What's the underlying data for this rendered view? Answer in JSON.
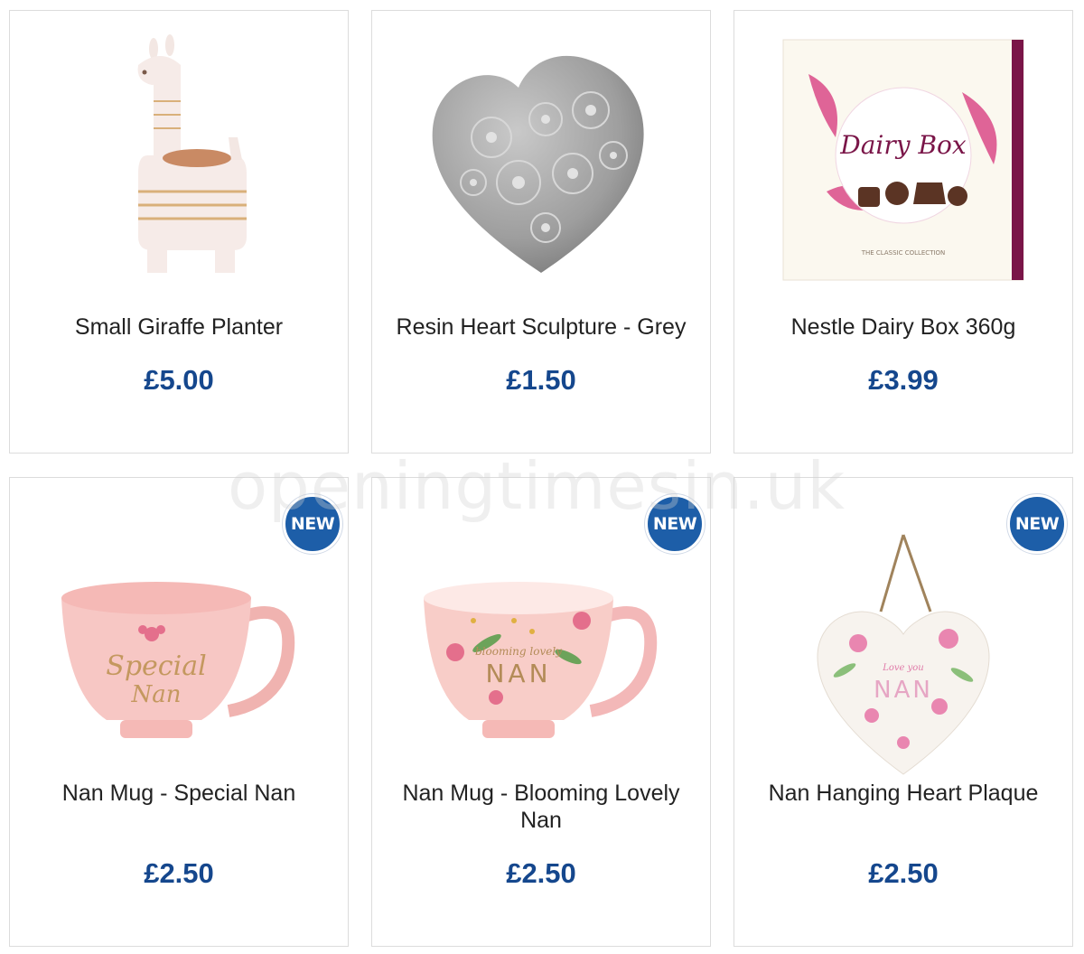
{
  "products": [
    {
      "name": "Small Giraffe Planter",
      "price": "£5.00",
      "image": "giraffe-planter"
    },
    {
      "name": "Resin Heart Sculpture - Grey",
      "price": "£1.50",
      "image": "heart-sculpture"
    },
    {
      "name": "Nestle Dairy Box 360g",
      "price": "£3.99",
      "image": "dairy-box"
    },
    {
      "name": "Nan Mug - Special Nan",
      "price": "£2.50",
      "image": "special-nan-mug",
      "badge": "NEW"
    },
    {
      "name": "Nan Mug - Blooming Lovely Nan",
      "price": "£2.50",
      "image": "blooming-nan-mug",
      "badge": "NEW"
    },
    {
      "name": "Nan Hanging Heart Plaque",
      "price": "£2.50",
      "image": "heart-plaque",
      "badge": "NEW"
    }
  ],
  "images": {
    "dairy_box_brand": "Dairy Box",
    "dairy_box_tagline": "THE CLASSIC COLLECTION",
    "special_mug_text_1": "Special",
    "special_mug_text_2": "Nan",
    "blooming_mug_text_1": "blooming lovely",
    "blooming_mug_text_2": "NAN",
    "plaque_text_1": "Love you",
    "plaque_text_2": "NAN"
  },
  "watermark": "openingtimesin.uk",
  "colors": {
    "price": "#15478d",
    "badge": "#1d5ea8"
  }
}
